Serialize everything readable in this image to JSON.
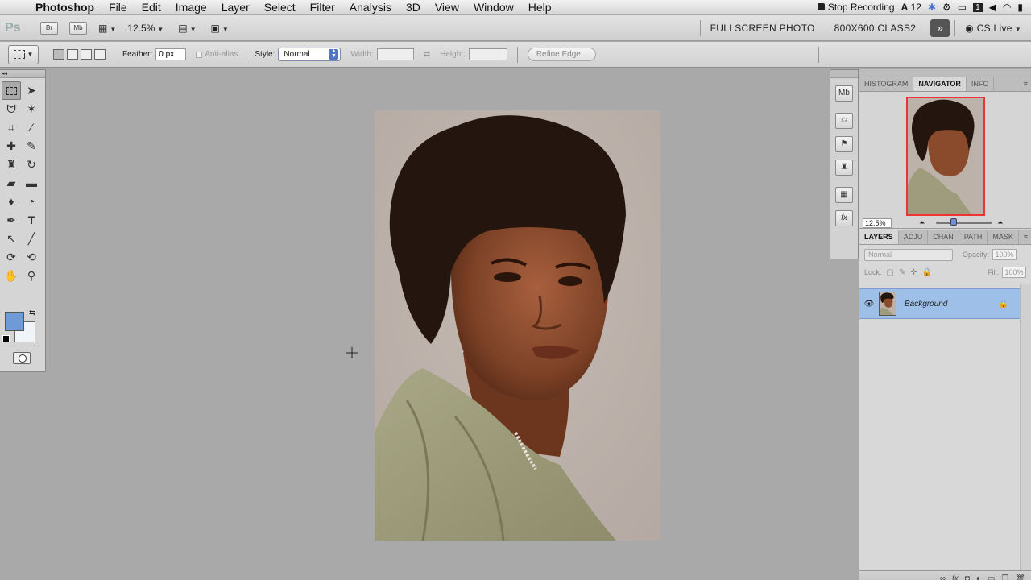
{
  "menubar": {
    "app_name": "Photoshop",
    "items": [
      "File",
      "Edit",
      "Image",
      "Layer",
      "Select",
      "Filter",
      "Analysis",
      "3D",
      "View",
      "Window",
      "Help"
    ],
    "status": {
      "recording": "Stop Recording",
      "adobe_count": "12"
    }
  },
  "appbar": {
    "logo": "Ps",
    "bridge": "Br",
    "minibridge": "Mb",
    "zoom": "12.5%",
    "workspaces": [
      "FULLSCREEN PHOTO",
      "800X600 CLASS2"
    ],
    "cs_live": "CS Live"
  },
  "options": {
    "feather_label": "Feather:",
    "feather_value": "0 px",
    "antialias_label": "Anti-alias",
    "style_label": "Style:",
    "style_value": "Normal",
    "width_label": "Width:",
    "height_label": "Height:",
    "refine_edge": "Refine Edge..."
  },
  "tools": {
    "foreground_color": "#6e9ad6",
    "background_color": "#eef4f8"
  },
  "navigator_panel": {
    "tabs": [
      "HISTOGRAM",
      "NAVIGATOR",
      "INFO"
    ],
    "active_tab": "NAVIGATOR",
    "zoom": "12.5%"
  },
  "layers_panel": {
    "tabs": [
      "LAYERS",
      "ADJU",
      "CHAN",
      "PATH",
      "MASK"
    ],
    "active_tab": "LAYERS",
    "blend_mode": "Normal",
    "opacity_label": "Opacity:",
    "opacity_value": "100%",
    "lock_label": "Lock:",
    "fill_label": "Fill:",
    "fill_value": "100%",
    "layers": [
      {
        "name": "Background",
        "visible": true,
        "locked": true
      }
    ]
  }
}
